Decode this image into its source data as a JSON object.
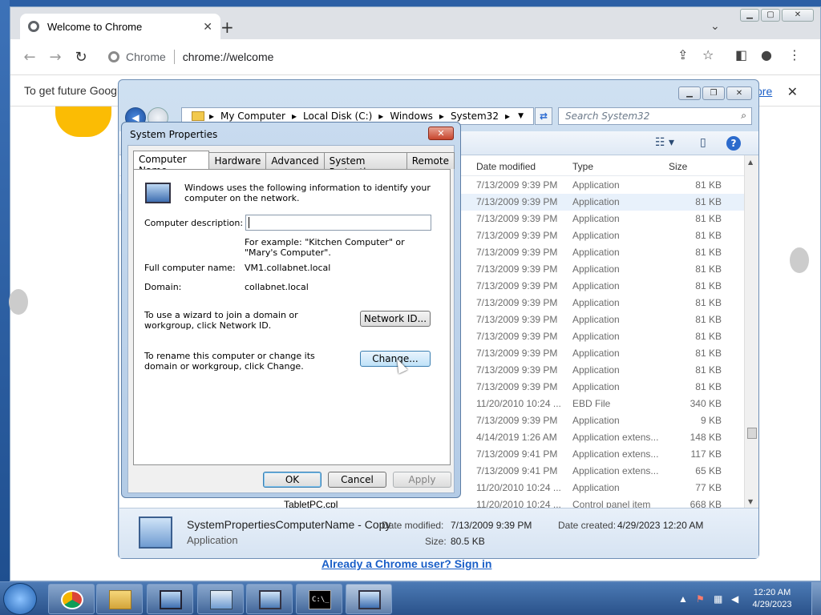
{
  "chrome": {
    "tab_title": "Welcome to Chrome",
    "new_tab": "+",
    "close_tab": "✕",
    "omnibox_site": "Chrome",
    "omnibox_url": "chrome://welcome",
    "infobar_text": "To get future Google",
    "infobar_more": "ore",
    "signin_link": "Already a Chrome user? Sign in"
  },
  "explorer": {
    "breadcrumb": [
      "My Computer",
      "Local Disk (C:)",
      "Windows",
      "System32"
    ],
    "search_placeholder": "Search System32",
    "columns": {
      "date": "Date modified",
      "type": "Type",
      "size": "Size"
    },
    "rows": [
      {
        "date": "7/13/2009 9:39 PM",
        "type": "Application",
        "size": "81 KB"
      },
      {
        "date": "7/13/2009 9:39 PM",
        "type": "Application",
        "size": "81 KB",
        "selected": true
      },
      {
        "date": "7/13/2009 9:39 PM",
        "type": "Application",
        "size": "81 KB"
      },
      {
        "date": "7/13/2009 9:39 PM",
        "type": "Application",
        "size": "81 KB"
      },
      {
        "date": "7/13/2009 9:39 PM",
        "type": "Application",
        "size": "81 KB"
      },
      {
        "date": "7/13/2009 9:39 PM",
        "type": "Application",
        "size": "81 KB"
      },
      {
        "date": "7/13/2009 9:39 PM",
        "type": "Application",
        "size": "81 KB"
      },
      {
        "date": "7/13/2009 9:39 PM",
        "type": "Application",
        "size": "81 KB"
      },
      {
        "date": "7/13/2009 9:39 PM",
        "type": "Application",
        "size": "81 KB"
      },
      {
        "date": "7/13/2009 9:39 PM",
        "type": "Application",
        "size": "81 KB"
      },
      {
        "date": "7/13/2009 9:39 PM",
        "type": "Application",
        "size": "81 KB"
      },
      {
        "date": "7/13/2009 9:39 PM",
        "type": "Application",
        "size": "81 KB"
      },
      {
        "date": "7/13/2009 9:39 PM",
        "type": "Application",
        "size": "81 KB"
      },
      {
        "date": "11/20/2010 10:24 ...",
        "type": "EBD File",
        "size": "340 KB"
      },
      {
        "date": "7/13/2009 9:39 PM",
        "type": "Application",
        "size": "9 KB"
      },
      {
        "date": "4/14/2019 1:26 AM",
        "type": "Application extens...",
        "size": "148 KB"
      },
      {
        "date": "7/13/2009 9:41 PM",
        "type": "Application extens...",
        "size": "117 KB"
      },
      {
        "date": "7/13/2009 9:41 PM",
        "type": "Application extens...",
        "size": "65 KB"
      },
      {
        "date": "11/20/2010 10:24 ...",
        "type": "Application",
        "size": "77 KB"
      },
      {
        "date": "11/20/2010 10:24 ...",
        "type": "Control panel item",
        "size": "668 KB",
        "name": "TabletPC.cpl"
      }
    ],
    "details": {
      "name": "SystemPropertiesComputerName - Copy",
      "type": "Application",
      "modified_label": "Date modified:",
      "modified": "7/13/2009 9:39 PM",
      "created_label": "Date created:",
      "created": "4/29/2023 12:20 AM",
      "size_label": "Size:",
      "size": "80.5 KB"
    }
  },
  "dialog": {
    "title": "System Properties",
    "tabs": [
      "Computer Name",
      "Hardware",
      "Advanced",
      "System Protection",
      "Remote"
    ],
    "intro": "Windows uses the following information to identify your computer on the network.",
    "desc_label": "Computer description:",
    "desc_value": "",
    "example": "For example: \"Kitchen Computer\" or \"Mary's Computer\".",
    "fullname_label": "Full computer name:",
    "fullname": "VM1.collabnet.local",
    "domain_label": "Domain:",
    "domain": "collabnet.local",
    "wizard_text": "To use a wizard to join a domain or workgroup, click Network ID.",
    "network_id": "Network ID...",
    "rename_text": "To rename this computer or change its domain or workgroup, click Change.",
    "change": "Change...",
    "ok": "OK",
    "cancel": "Cancel",
    "apply": "Apply"
  },
  "taskbar": {
    "time": "12:20 AM",
    "date": "4/29/2023"
  }
}
